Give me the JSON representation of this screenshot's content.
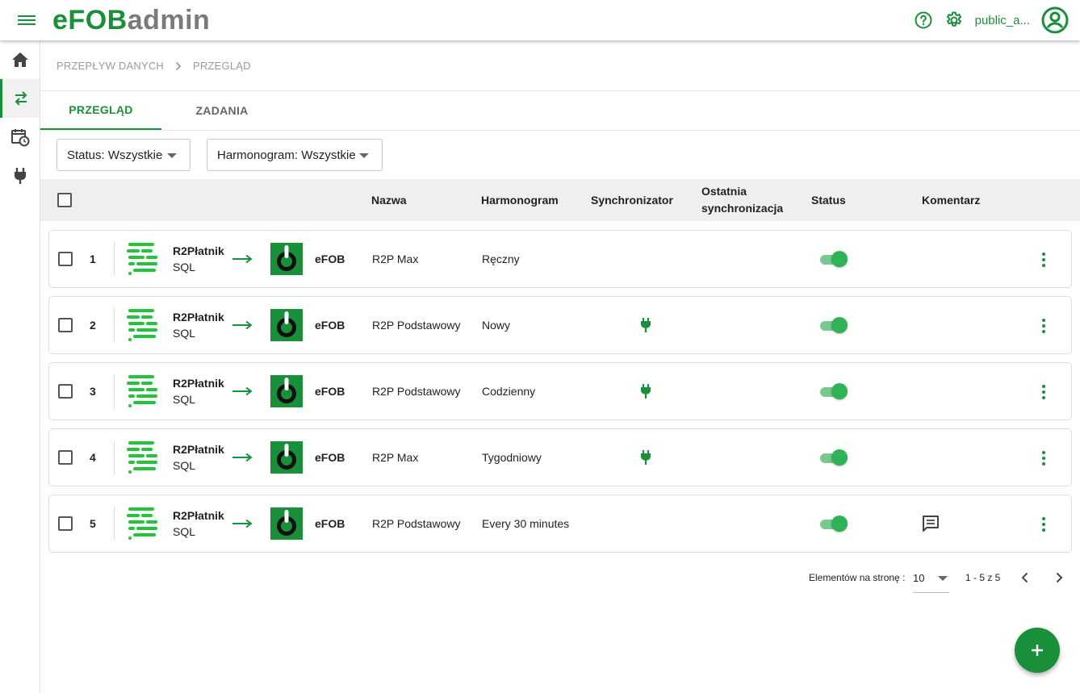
{
  "header": {
    "logo_e": "e",
    "logo_fob": "FOB",
    "logo_admin": "admin",
    "user_name": "public_a..."
  },
  "breadcrumb": {
    "items": [
      "PRZEPŁYW DANYCH",
      "PRZEGLĄD"
    ]
  },
  "tabs": [
    {
      "label": "PRZEGLĄD",
      "active": true
    },
    {
      "label": "ZADANIA",
      "active": false
    }
  ],
  "filters": {
    "status": "Status: Wszystkie",
    "schedule": "Harmonogram: Wszystkie"
  },
  "table": {
    "headers": {
      "name": "Nazwa",
      "schedule": "Harmonogram",
      "sync": "Synchronizator",
      "last_sync_1": "Ostatnia",
      "last_sync_2": "synchronizacja",
      "status": "Status",
      "comment": "Komentarz"
    },
    "rows": [
      {
        "num": "1",
        "src": "R2Płatnik",
        "src_sub": "SQL",
        "dst": "eFOB",
        "name": "R2P Max",
        "schedule": "Ręczny",
        "sync": false,
        "status": true,
        "comment": false
      },
      {
        "num": "2",
        "src": "R2Płatnik",
        "src_sub": "SQL",
        "dst": "eFOB",
        "name": "R2P Podstawowy",
        "schedule": "Nowy",
        "sync": true,
        "status": true,
        "comment": false
      },
      {
        "num": "3",
        "src": "R2Płatnik",
        "src_sub": "SQL",
        "dst": "eFOB",
        "name": "R2P Podstawowy",
        "schedule": "Codzienny",
        "sync": true,
        "status": true,
        "comment": false
      },
      {
        "num": "4",
        "src": "R2Płatnik",
        "src_sub": "SQL",
        "dst": "eFOB",
        "name": "R2P Max",
        "schedule": "Tygodniowy",
        "sync": true,
        "status": true,
        "comment": false
      },
      {
        "num": "5",
        "src": "R2Płatnik",
        "src_sub": "SQL",
        "dst": "eFOB",
        "name": "R2P Podstawowy",
        "schedule": "Every 30 minutes",
        "sync": false,
        "status": true,
        "comment": true
      }
    ]
  },
  "paginator": {
    "per_page_label": "Elementów na stronę :",
    "per_page_value": "10",
    "range": "1 - 5 z 5"
  },
  "colors": {
    "accent": "#1a8f3a",
    "toggle_on": "#2fb356"
  },
  "icons": {
    "menu": "menu-icon",
    "help": "help-circle-icon",
    "settings": "gear-icon",
    "account": "account-circle-icon",
    "home": "home-icon",
    "data_flow": "swap-arrows-icon",
    "schedule": "calendar-clock-icon",
    "plugin": "plug-icon",
    "comment": "comment-icon",
    "add": "plus-icon"
  }
}
